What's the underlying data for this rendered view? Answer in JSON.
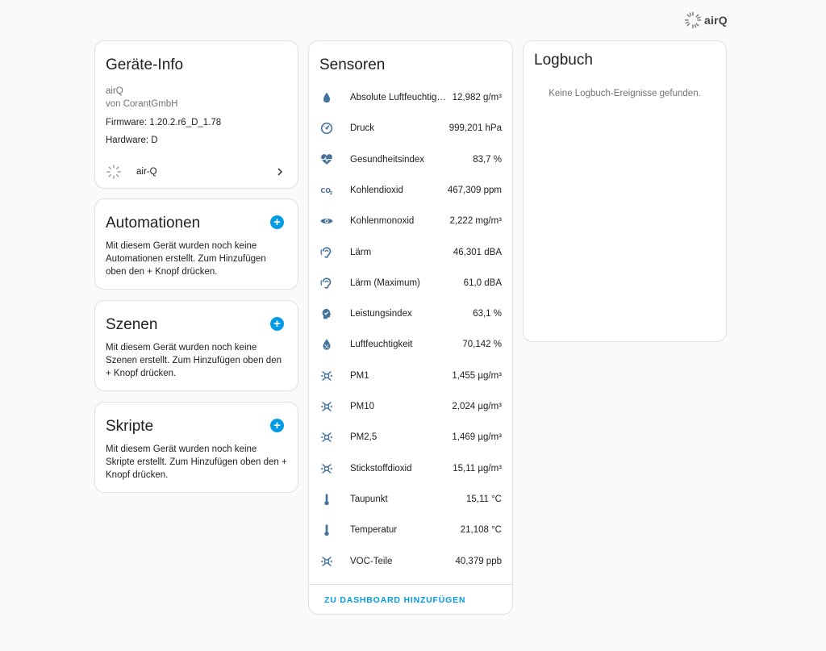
{
  "logo": {
    "text": "airQ"
  },
  "geraete_info": {
    "title": "Geräte-Info",
    "device_name": "airQ",
    "manufacturer": "von CorantGmbH",
    "firmware": "Firmware: 1.20.2.r6_D_1.78",
    "hardware": "Hardware: D",
    "integration_label": "air-Q"
  },
  "automationen": {
    "title": "Automationen",
    "text": "Mit diesem Gerät wurden noch keine Automationen erstellt. Zum Hinzufügen oben den + Knopf drücken."
  },
  "szenen": {
    "title": "Szenen",
    "text": "Mit diesem Gerät wurden noch keine Szenen erstellt. Zum Hinzufügen oben den + Knopf drücken."
  },
  "skripte": {
    "title": "Skripte",
    "text": "Mit diesem Gerät wurden noch keine Skripte erstellt. Zum Hinzufügen oben den + Knopf drücken."
  },
  "sensoren": {
    "title": "Sensoren",
    "footer_link": "ZU DASHBOARD HINZUFÜGEN",
    "items": [
      {
        "name": "Absolute Luftfeuchtigkeit",
        "value": "12,982 g/m³",
        "icon": "water-drop-icon"
      },
      {
        "name": "Druck",
        "value": "999,201 hPa",
        "icon": "gauge-icon"
      },
      {
        "name": "Gesundheitsindex",
        "value": "83,7 %",
        "icon": "heart-pulse-icon"
      },
      {
        "name": "Kohlendioxid",
        "value": "467,309 ppm",
        "icon": "co2-icon"
      },
      {
        "name": "Kohlenmonoxid",
        "value": "2,222 mg/m³",
        "icon": "eye-icon"
      },
      {
        "name": "Lärm",
        "value": "46,301 dBA",
        "icon": "ear-icon"
      },
      {
        "name": "Lärm (Maximum)",
        "value": "61,0 dBA",
        "icon": "ear-icon"
      },
      {
        "name": "Leistungsindex",
        "value": "63,1 %",
        "icon": "head-check-icon"
      },
      {
        "name": "Luftfeuchtigkeit",
        "value": "70,142 %",
        "icon": "water-percent-icon"
      },
      {
        "name": "PM1",
        "value": "1,455 µg/m³",
        "icon": "particles-icon"
      },
      {
        "name": "PM10",
        "value": "2,024 µg/m³",
        "icon": "particles-icon"
      },
      {
        "name": "PM2,5",
        "value": "1,469 µg/m³",
        "icon": "particles-icon"
      },
      {
        "name": "Stickstoffdioxid",
        "value": "15,11 µg/m³",
        "icon": "particles-icon"
      },
      {
        "name": "Taupunkt",
        "value": "15,11 °C",
        "icon": "thermometer-icon"
      },
      {
        "name": "Temperatur",
        "value": "21,108 °C",
        "icon": "thermometer-icon"
      },
      {
        "name": "VOC-Teile",
        "value": "40,379 ppb",
        "icon": "particles-icon"
      }
    ]
  },
  "logbuch": {
    "title": "Logbuch",
    "empty_text": "Keine Logbuch-Ereignisse gefunden."
  },
  "colors": {
    "accent": "#039be5",
    "icon": "#44739e"
  }
}
